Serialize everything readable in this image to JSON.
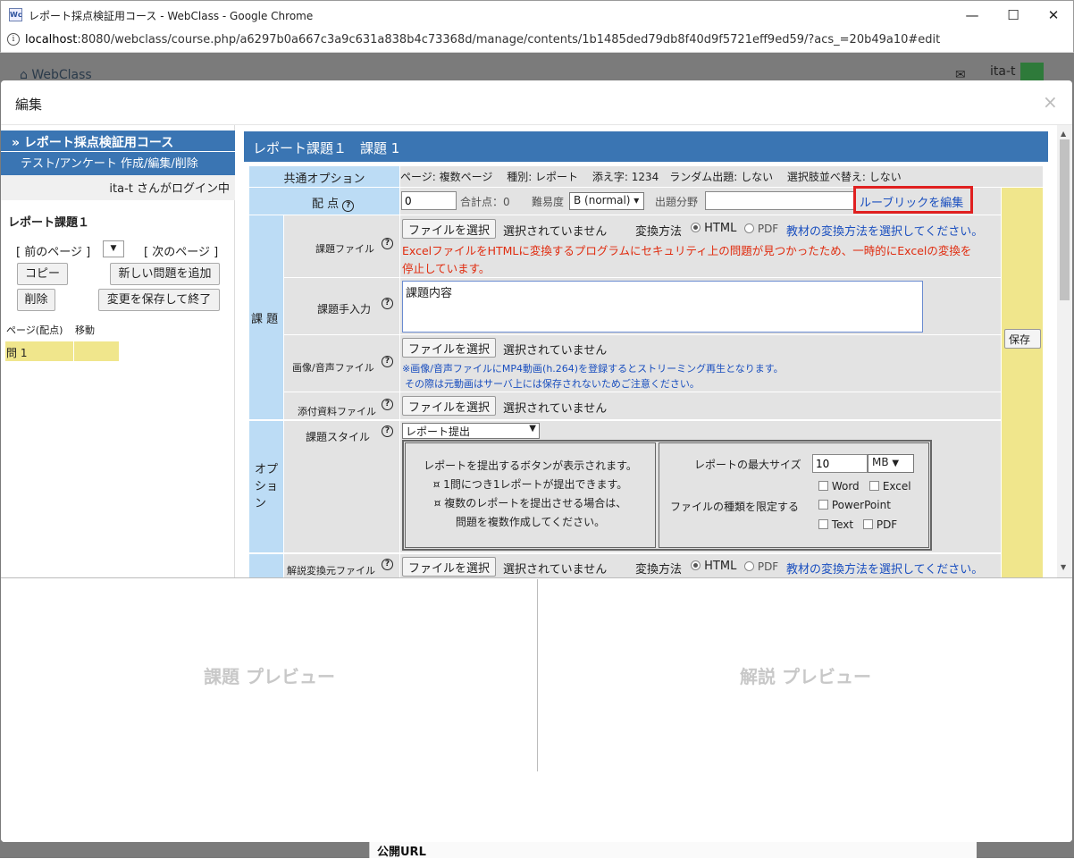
{
  "window": {
    "title": "レポート採点検証用コース - WebClass - Google Chrome",
    "minimize": "—",
    "maximize": "☐",
    "close": "✕"
  },
  "address": {
    "url_host": "localhost",
    "url_rest": ":8080/webclass/course.php/a6297b0a667c3a9c631a838b4c73368d/manage/contents/1b1485ded79db8f40d9f5721eff9ed59/?acs_=20b49a10#edit"
  },
  "app": {
    "home": "WebClass",
    "user": "ita-t",
    "public_url": "公開URL"
  },
  "modal": {
    "title": "編集",
    "close": "×"
  },
  "sidebar": {
    "course_name": "» レポート採点検証用コース",
    "course_sub": "テスト/アンケート 作成/編集/削除",
    "login": "ita-t さんがログイン中",
    "assignment_title": "レポート課題１",
    "prev_page": "[ 前のページ ]",
    "page_select": "▼",
    "next_page": "[ 次のページ ]",
    "copy_button": "コピー",
    "add_question_button": "新しい問題を追加",
    "delete_button": "削除",
    "save_exit_button": "変更を保存して終了",
    "col_page": "ページ(配点)",
    "col_move": "移動",
    "question_item": "問 1"
  },
  "form": {
    "header": "レポート課題１　課題 1",
    "common_option_label": "共通オプション",
    "common_option_value": "ページ: 複数ページ　 種別: レポート　 添え字: 1234　ランダム出題: しない　 選択肢並べ替え: しない",
    "points_label": "配 点",
    "points_value": "0",
    "total_points": "合計点：0",
    "difficulty_label": "難易度",
    "difficulty_value": "B (normal)",
    "category_label": "出題分野",
    "category_value": "",
    "rubric_link": "ルーブリックを編集",
    "save_button": "保存",
    "section_task": "課 題",
    "section_option": "オプ\nショ\nン",
    "task_file_label": "課題ファイル",
    "choose_file": "ファイルを選択",
    "no_file": "選択されていません",
    "convert_method": "変換方法",
    "html_label": "HTML",
    "pdf_label": "PDF",
    "convert_help_link": "教材の変換方法を選択してください。",
    "excel_warning_1": "ExcelファイルをHTMLに変換するプログラムにセキュリティ上の問題が見つかったため、一時的にExcelの変換を",
    "excel_warning_2": "停止しています。",
    "manual_input_label": "課題手入力",
    "manual_input_value": "課題内容",
    "media_file_label": "画像/音声ファイル",
    "media_note_1": "※画像/音声ファイルにMP4動画(h.264)を登録するとストリーミング再生となります。",
    "media_note_2": "その際は元動画はサーバ上には保存されないためご注意ください。",
    "attachment_label": "添付資料ファイル",
    "style_label": "課題スタイル",
    "style_value": "レポート提出",
    "style_desc_1": "レポートを提出するボタンが表示されます。",
    "style_desc_2": "¤ 1問につき1レポートが提出できます。",
    "style_desc_3": "¤ 複数のレポートを提出させる場合は、",
    "style_desc_4": "問題を複数作成してください。",
    "max_size_label": "レポートの最大サイズ",
    "max_size_value": "10",
    "max_size_unit": "MB",
    "file_type_label": "ファイルの種類を限定する",
    "type_word": "Word",
    "type_excel": "Excel",
    "type_ppt": "PowerPoint",
    "type_text": "Text",
    "type_pdf": "PDF",
    "explain_file_label": "解説変換元ファイル"
  },
  "preview": {
    "task": "課題 プレビュー",
    "explain": "解説 プレビュー"
  }
}
